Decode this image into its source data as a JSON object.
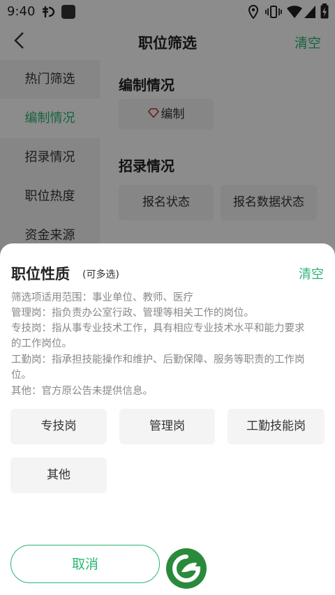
{
  "status_bar": {
    "time": "9:40",
    "icons": [
      "bug-icon",
      "square-icon",
      "location-icon",
      "vibrate-icon",
      "wifi-icon",
      "signal-icon",
      "battery-icon"
    ]
  },
  "header": {
    "title": "职位筛选",
    "clear_label": "清空"
  },
  "sidebar": {
    "items": [
      {
        "label": "热门筛选",
        "active": false
      },
      {
        "label": "编制情况",
        "active": true
      },
      {
        "label": "招录情况",
        "active": false
      },
      {
        "label": "职位热度",
        "active": false
      },
      {
        "label": "资金来源",
        "active": false
      }
    ]
  },
  "content": {
    "sections": [
      {
        "title": "编制情况",
        "chips": [
          {
            "label": "编制",
            "icon": "diamond-icon"
          }
        ]
      },
      {
        "title": "招录情况",
        "chips": [
          {
            "label": "报名状态"
          },
          {
            "label": "报名数据状态"
          }
        ]
      }
    ]
  },
  "sheet": {
    "title": "职位性质",
    "subtitle": "(可多选)",
    "clear_label": "清空",
    "description_lines": [
      "筛选项适用范围：事业单位、教师、医疗",
      "管理岗：指负责办公室行政、管理等相关工作的岗位。",
      "专技岗：指从事专业技术工作，具有相应专业技术水平和能力要求",
      "的工作岗位。",
      "工勤岗：指承担技能操作和维护、后勤保障、服务等职责的工作岗",
      "位。",
      "其他：官方原公告未提供信息。"
    ],
    "options": [
      "专技岗",
      "管理岗",
      "工勤技能岗",
      "其他"
    ],
    "cancel_label": "取消"
  },
  "colors": {
    "accent": "#2bb673",
    "overlay": "#000000"
  }
}
